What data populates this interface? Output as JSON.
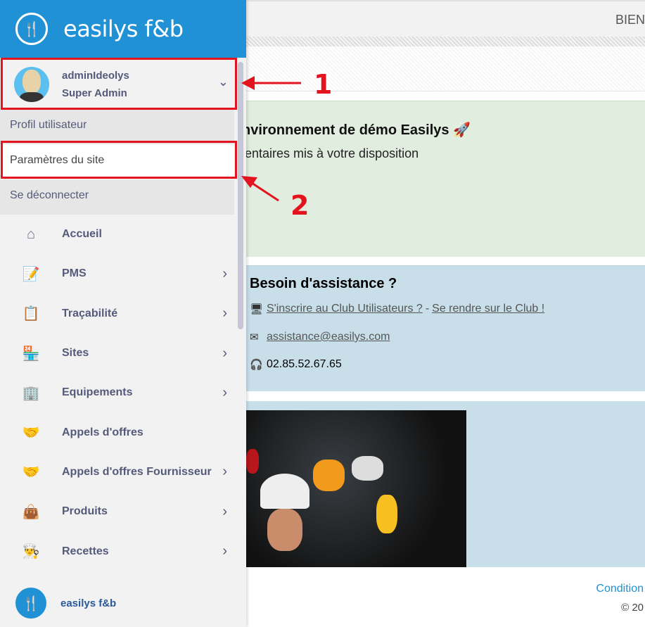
{
  "header": {
    "top_right_text": "BIEN"
  },
  "sidebar": {
    "brand": "easilys f&b",
    "user": {
      "name": "adminIdeolys",
      "role": "Super Admin"
    },
    "user_menu": [
      {
        "label": "Profil utilisateur"
      },
      {
        "label": "Paramètres du site"
      },
      {
        "label": "Se déconnecter"
      }
    ],
    "items": [
      {
        "label": "Accueil",
        "icon": "home-icon",
        "has_submenu": false
      },
      {
        "label": "PMS",
        "icon": "clipboard-edit-icon",
        "has_submenu": true
      },
      {
        "label": "Traçabilité",
        "icon": "clipboard-check-icon",
        "has_submenu": true
      },
      {
        "label": "Sites",
        "icon": "store-icon",
        "has_submenu": true
      },
      {
        "label": "Equipements",
        "icon": "building-icon",
        "has_submenu": true
      },
      {
        "label": "Appels d'offres",
        "icon": "handshake-icon",
        "has_submenu": false
      },
      {
        "label": "Appels d'offres Fournisseur",
        "icon": "handshake-icon",
        "has_submenu": true
      },
      {
        "label": "Produits",
        "icon": "bag-icon",
        "has_submenu": true
      },
      {
        "label": "Recettes",
        "icon": "chef-hat-icon",
        "has_submenu": true
      }
    ],
    "footer_brand": "easilys f&b"
  },
  "main": {
    "demo_title": "nvironnement de démo Easilys 🚀",
    "demo_text": "entaires mis à votre disposition",
    "support": {
      "title": "Besoin d'assistance ?",
      "club_signup": "S'inscrire au Club Utilisateurs ?",
      "separator": "-",
      "club_visit": "Se rendre sur le Club !",
      "email": "assistance@easilys.com",
      "phone": "02.85.52.67.65"
    },
    "footer_link": "Condition",
    "copyright": "© 20"
  },
  "annotations": {
    "label_1": "1",
    "label_2": "2",
    "color": "#e3141e"
  }
}
